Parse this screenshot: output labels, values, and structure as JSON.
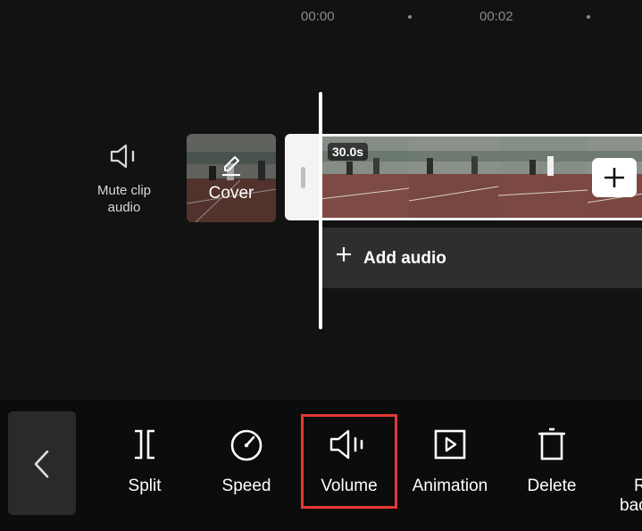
{
  "timeline": {
    "times": [
      "00:00",
      "00:02"
    ]
  },
  "mute": {
    "label_line1": "Mute clip",
    "label_line2": "audio",
    "icon": "speaker-icon"
  },
  "cover": {
    "label": "Cover",
    "icon": "edit-pencil-icon"
  },
  "clip": {
    "duration": "30.0s",
    "add_icon": "plus-icon"
  },
  "audio": {
    "label": "Add audio",
    "icon": "plus-icon"
  },
  "toolbar": {
    "back_icon": "chevron-left-icon",
    "tools": [
      {
        "label": "Split",
        "icon": "split-icon"
      },
      {
        "label": "Speed",
        "icon": "speedometer-icon"
      },
      {
        "label": "Volume",
        "icon": "volume-icon",
        "highlighted": true
      },
      {
        "label": "Animation",
        "icon": "play-box-icon"
      },
      {
        "label": "Delete",
        "icon": "trash-icon"
      }
    ],
    "partial_tool": {
      "line1": "R",
      "line2": "bac"
    }
  },
  "colors": {
    "background": "#121212",
    "toolbar": "#0c0c0c",
    "highlight": "#e53935",
    "audio_track": "#2e2e2e"
  }
}
